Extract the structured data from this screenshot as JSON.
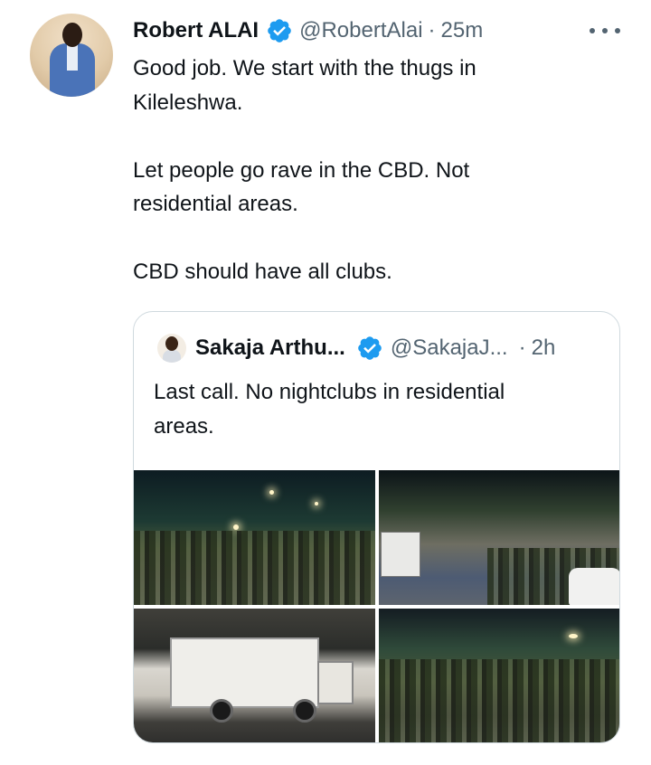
{
  "tweet": {
    "author_name": "Robert ALAI",
    "handle": "@RobertAlai",
    "separator": "·",
    "time": "25m",
    "paragraphs": [
      "Good job. We start with the thugs in\nKileleshwa.",
      "Let people go rave in the CBD. Not\nresidential areas.",
      "CBD should have all clubs."
    ]
  },
  "quote": {
    "author_name": "Sakaja Arthu...",
    "handle": "@SakajaJ...",
    "separator": "·",
    "time": "2h",
    "text": "Last call. No nightclubs in residential\nareas."
  },
  "icons": {
    "verified": "verified-badge-icon",
    "more": "more-options-icon"
  },
  "colors": {
    "verified_blue": "#1d9bf0",
    "secondary_text": "#536471",
    "primary_text": "#0f1419",
    "border": "#cfd9de"
  }
}
